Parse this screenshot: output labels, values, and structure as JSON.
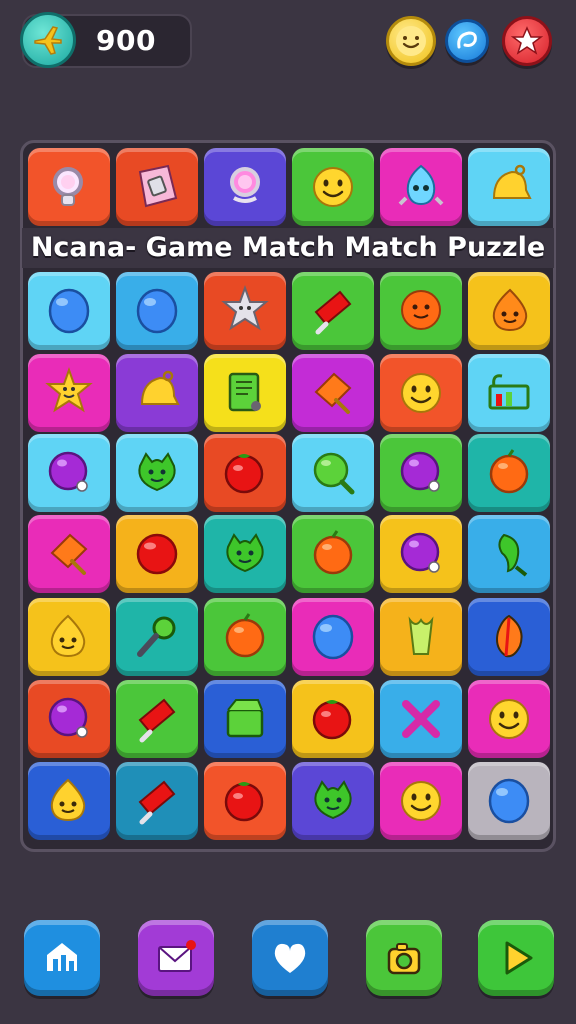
{
  "header": {
    "score": "900",
    "score_icon": "airplane-icon",
    "buttons": [
      {
        "name": "smiley-face-button",
        "icon": "smiley-icon",
        "color": "#f0c21b"
      },
      {
        "name": "refresh-button",
        "icon": "swirl-icon",
        "color": "#1779d8"
      },
      {
        "name": "star-button",
        "icon": "star-icon",
        "color": "#d6202a"
      }
    ]
  },
  "title": "Ncana- Game Match Match Puzzle",
  "board": {
    "rows": [
      [
        {
          "bg": "#f2542a",
          "icon": "magnifier"
        },
        {
          "bg": "#e84a24",
          "icon": "paper"
        },
        {
          "bg": "#5b47d6",
          "icon": "magnifier-pink"
        },
        {
          "bg": "#4bc63a",
          "icon": "face-yellow"
        },
        {
          "bg": "#e92cb8",
          "icon": "creature-blue"
        },
        {
          "bg": "#5fd4f5",
          "icon": "bell"
        }
      ],
      [
        {
          "bg": "#5fd4f5",
          "icon": "orb-blue"
        },
        {
          "bg": "#39aee9",
          "icon": "orb-blue"
        },
        {
          "bg": "#e84a24",
          "icon": "star-gray"
        },
        {
          "bg": "#4bc63a",
          "icon": "cone-red"
        },
        {
          "bg": "#4bc63a",
          "icon": "flower-orange"
        },
        {
          "bg": "#f5c21b",
          "icon": "drop-orange"
        }
      ],
      [
        {
          "bg": "#e92cb8",
          "icon": "star-yellow"
        },
        {
          "bg": "#8a3bd6",
          "icon": "bell"
        },
        {
          "bg": "#f5e01b",
          "icon": "book-green"
        },
        {
          "bg": "#c32cd6",
          "icon": "cone-orange"
        },
        {
          "bg": "#f2542a",
          "icon": "face-yellow"
        },
        {
          "bg": "#5fd4f5",
          "icon": "cart"
        }
      ],
      [
        {
          "bg": "#5fd4f5",
          "icon": "orb-purple"
        },
        {
          "bg": "#5fd4f5",
          "icon": "creature-green"
        },
        {
          "bg": "#e84a24",
          "icon": "tomato"
        },
        {
          "bg": "#5fd4f5",
          "icon": "orb-green"
        },
        {
          "bg": "#4bc63a",
          "icon": "orb-purple"
        },
        {
          "bg": "#1fb5a8",
          "icon": "orb-orange"
        }
      ],
      [
        {
          "bg": "#e92cb8",
          "icon": "cone-orange"
        },
        {
          "bg": "#f5b21b",
          "icon": "orb-red"
        },
        {
          "bg": "#1fb5a8",
          "icon": "creature-green"
        },
        {
          "bg": "#4bc63a",
          "icon": "orb-orange"
        },
        {
          "bg": "#f5c21b",
          "icon": "orb-purple"
        },
        {
          "bg": "#39aee9",
          "icon": "pepper-green"
        }
      ],
      [
        {
          "bg": "#f5c21b",
          "icon": "drop-yellow"
        },
        {
          "bg": "#1fb5a8",
          "icon": "key"
        },
        {
          "bg": "#4bc63a",
          "icon": "orb-orange"
        },
        {
          "bg": "#e92cb8",
          "icon": "orb-blue"
        },
        {
          "bg": "#f5b21b",
          "icon": "celery"
        },
        {
          "bg": "#2a5fd6",
          "icon": "leaf"
        }
      ],
      [
        {
          "bg": "#e84a24",
          "icon": "orb-purple"
        },
        {
          "bg": "#4bc63a",
          "icon": "cone-red"
        },
        {
          "bg": "#2a5fd6",
          "icon": "box-green"
        },
        {
          "bg": "#f5c21b",
          "icon": "tomato"
        },
        {
          "bg": "#39aee9",
          "icon": "cross"
        },
        {
          "bg": "#e92cb8",
          "icon": "face-yellow"
        }
      ],
      [
        {
          "bg": "#2a5fd6",
          "icon": "drop-yellow"
        },
        {
          "bg": "#1f8fb8",
          "icon": "cone-red"
        },
        {
          "bg": "#f2542a",
          "icon": "tomato"
        },
        {
          "bg": "#5b47d6",
          "icon": "creature-green"
        },
        {
          "bg": "#e92cb8",
          "icon": "face-yellow"
        },
        {
          "bg": "#b9b4bd",
          "icon": "orb-blue"
        }
      ]
    ]
  },
  "bottom_bar": [
    {
      "name": "home-button",
      "icon": "home-icon",
      "color": "#1f8fe0"
    },
    {
      "name": "mail-button",
      "icon": "mail-icon",
      "color": "#a23bd6"
    },
    {
      "name": "heart-button",
      "icon": "heart-icon",
      "color": "#1f7fd0"
    },
    {
      "name": "camera-button",
      "icon": "camera-icon",
      "color": "#4bc63a"
    },
    {
      "name": "play-button",
      "icon": "play-icon",
      "color": "#3ec63a"
    }
  ]
}
